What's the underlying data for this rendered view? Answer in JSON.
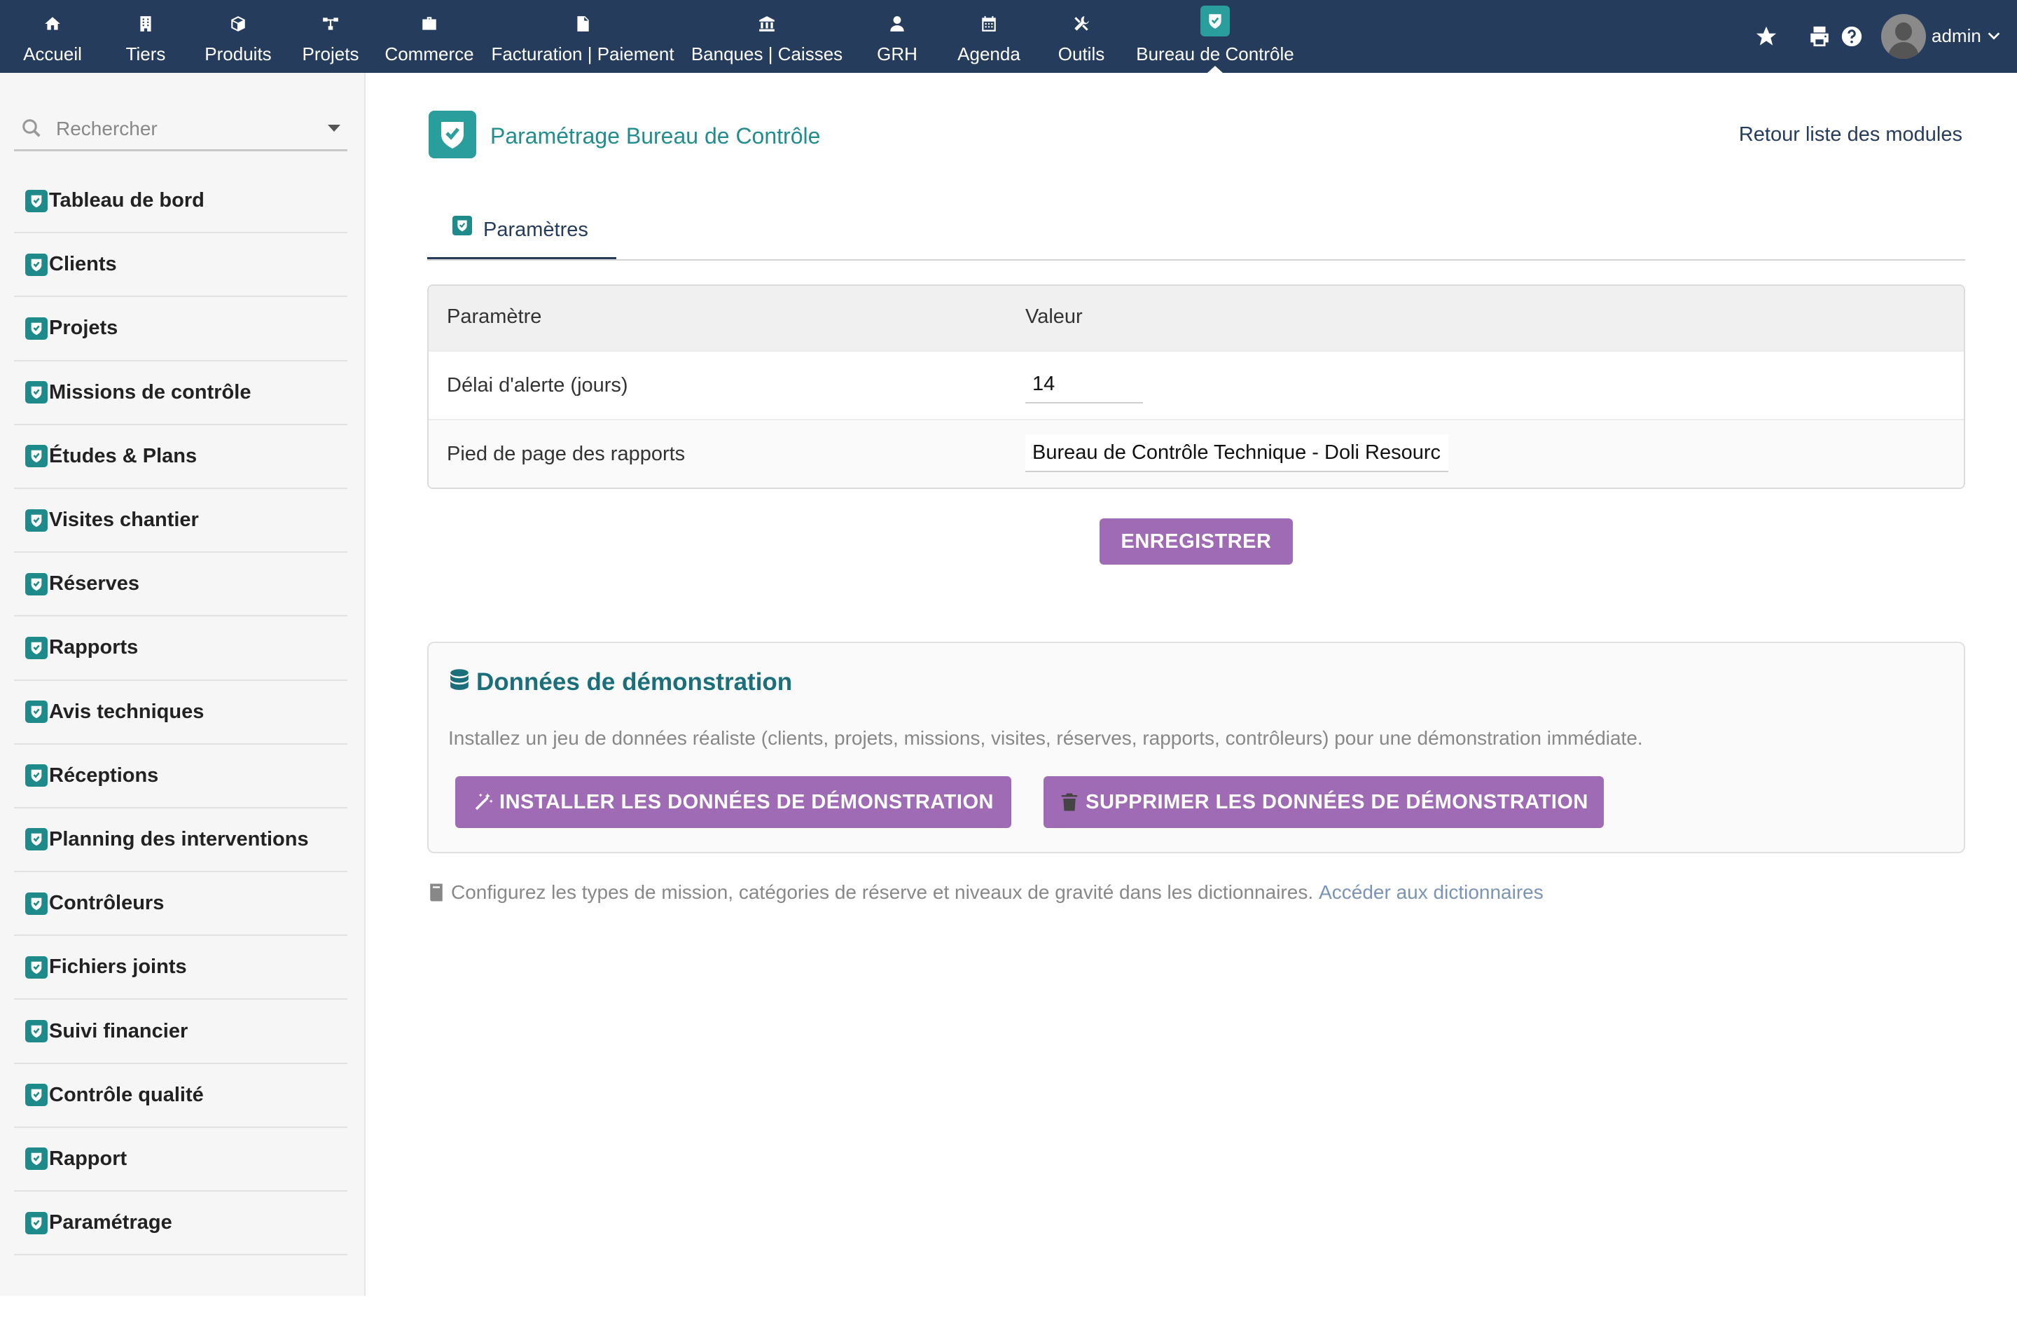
{
  "topbar": {
    "menu": [
      {
        "label": "Accueil",
        "icon": "home-icon"
      },
      {
        "label": "Tiers",
        "icon": "building-icon"
      },
      {
        "label": "Produits",
        "icon": "cube-icon"
      },
      {
        "label": "Projets",
        "icon": "project-tree-icon"
      },
      {
        "label": "Commerce",
        "icon": "briefcase-icon"
      },
      {
        "label": "Facturation | Paiement",
        "icon": "invoice-icon"
      },
      {
        "label": "Banques | Caisses",
        "icon": "bank-icon"
      },
      {
        "label": "GRH",
        "icon": "user-tie-icon"
      },
      {
        "label": "Agenda",
        "icon": "calendar-icon"
      },
      {
        "label": "Outils",
        "icon": "tools-icon"
      },
      {
        "label": "Bureau de Contrôle",
        "icon": "shield-check-icon",
        "active": true
      }
    ],
    "username": "admin",
    "accent_color": "#263c5c"
  },
  "sidebar": {
    "search_placeholder": "Rechercher",
    "items": [
      {
        "label": "Tableau de bord"
      },
      {
        "label": "Clients"
      },
      {
        "label": "Projets"
      },
      {
        "label": "Missions de contrôle"
      },
      {
        "label": "Études & Plans"
      },
      {
        "label": "Visites chantier"
      },
      {
        "label": "Réserves"
      },
      {
        "label": "Rapports"
      },
      {
        "label": "Avis techniques"
      },
      {
        "label": "Réceptions"
      },
      {
        "label": "Planning des interventions"
      },
      {
        "label": "Contrôleurs"
      },
      {
        "label": "Fichiers joints"
      },
      {
        "label": "Suivi financier"
      },
      {
        "label": "Contrôle qualité"
      },
      {
        "label": "Rapport"
      },
      {
        "label": "Paramétrage"
      }
    ]
  },
  "main": {
    "title": "Paramétrage Bureau de Contrôle",
    "back_link": "Retour liste des modules",
    "tab_label": "Paramètres",
    "table": {
      "col_param": "Paramètre",
      "col_value": "Valeur",
      "rows": [
        {
          "label": "Délai d'alerte (jours)",
          "value": "14"
        },
        {
          "label": "Pied de page des rapports",
          "value": "Bureau de Contrôle Technique - Doli Resourc"
        }
      ]
    },
    "save_button": "ENREGISTRER",
    "demo": {
      "title": "Données de démonstration",
      "description": "Installez un jeu de données réaliste (clients, projets, missions, visites, réserves, rapports, contrôleurs) pour une démonstration immédiate.",
      "install_button": "INSTALLER LES DONNÉES DE DÉMONSTRATION",
      "delete_button": "SUPPRIMER LES DONNÉES DE DÉMONSTRATION"
    },
    "footnote_text": "Configurez les types de mission, catégories de réserve et niveaux de gravité dans les dictionnaires.",
    "footnote_link": "Accéder aux dictionnaires",
    "button_color": "#a06bb5",
    "module_color": "#2a9d9d"
  }
}
